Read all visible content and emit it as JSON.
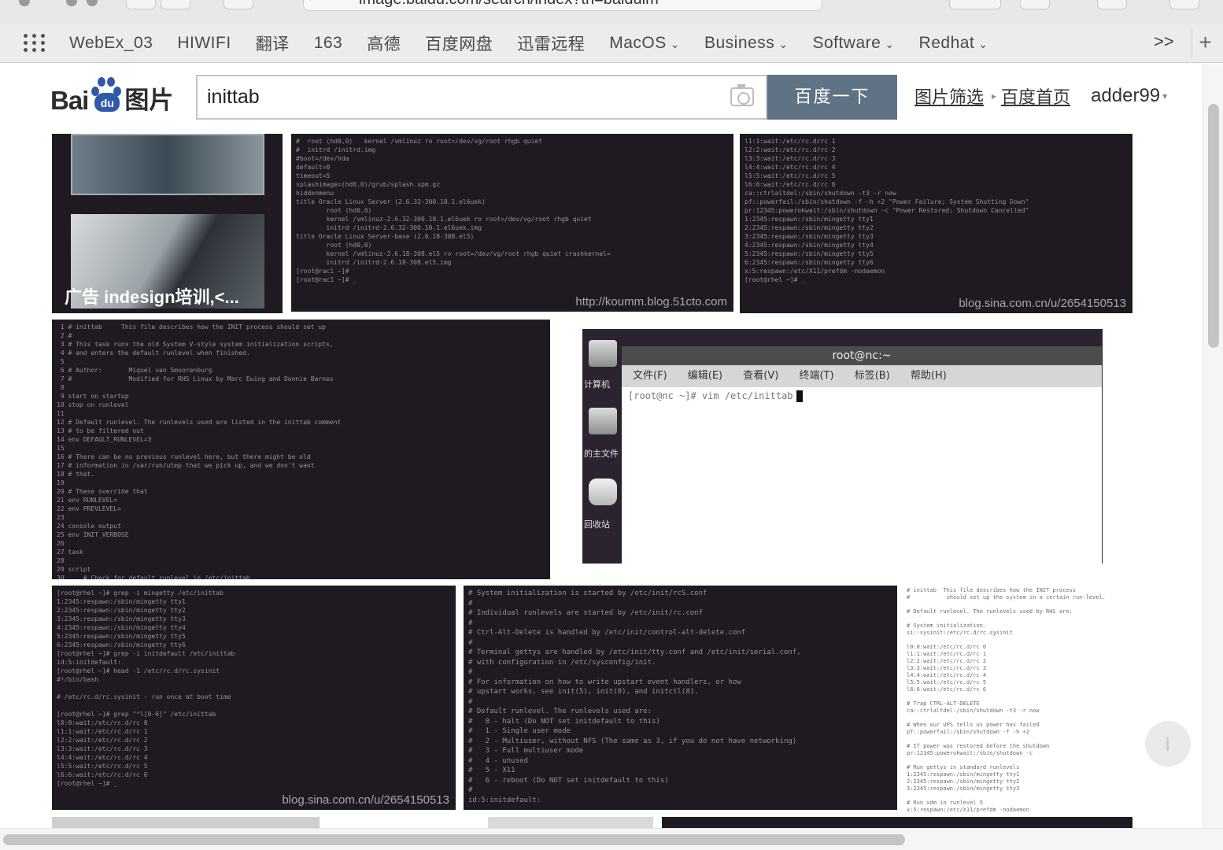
{
  "browser": {
    "url": "image.baidu.com/search/index?tn=baiduim",
    "bookmarks": [
      {
        "label": "WebEx_03",
        "dropdown": false
      },
      {
        "label": "HIWIFI",
        "dropdown": false
      },
      {
        "label": "翻译",
        "dropdown": false
      },
      {
        "label": "163",
        "dropdown": false
      },
      {
        "label": "高德",
        "dropdown": false
      },
      {
        "label": "百度网盘",
        "dropdown": false
      },
      {
        "label": "迅雷远程",
        "dropdown": false
      },
      {
        "label": "MacOS",
        "dropdown": true
      },
      {
        "label": "Business",
        "dropdown": true
      },
      {
        "label": "Software",
        "dropdown": true
      },
      {
        "label": "Redhat",
        "dropdown": true
      }
    ],
    "more_label": ">>",
    "new_tab_label": "+"
  },
  "header": {
    "logo_bai": "Bai",
    "logo_du": "du",
    "logo_pic": "图片",
    "search_value": "inittab",
    "search_button": "百度一下",
    "link_filter": "图片筛选",
    "link_home": "百度首页",
    "user": "adder99"
  },
  "results": {
    "ad_label": "广告 indesign培训,<...",
    "wm_51cto": "http://koumm.blog.51cto.com",
    "wm_sina_1": "blog.sina.com.cn/u/2654150513",
    "wm_sina_2": "blog.sina.com.cn/u/2654150513",
    "terminal_title": "root@nc:~",
    "terminal_menu": [
      "文件(F)",
      "编辑(E)",
      "查看(V)",
      "终端(T)",
      "标签(B)",
      "帮助(H)"
    ],
    "terminal_prompt": "[root@nc ~]# vim /etc/inittab",
    "desktop_icons": [
      "计算机",
      "的主文件",
      "回收站"
    ]
  },
  "colors": {
    "search_button_bg": "#5f7384",
    "logo_blue": "#2f5aa8",
    "terminal_bg": "#1f1a21"
  }
}
